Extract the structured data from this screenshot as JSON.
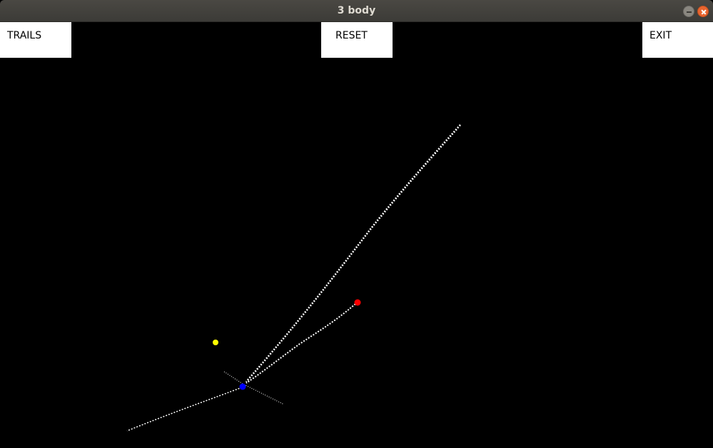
{
  "window": {
    "title": "3 body"
  },
  "toolbar": {
    "trails_label": "TRAILS",
    "reset_label": "RESET",
    "exit_label": "EXIT"
  },
  "bodies": [
    {
      "name": "yellow",
      "color": "#ffff00"
    },
    {
      "name": "red",
      "color": "#ff0000"
    },
    {
      "name": "blue",
      "color": "#0000ff"
    }
  ],
  "colors": {
    "background": "#000000",
    "trail": "#ffffff",
    "button_bg": "#ffffff"
  }
}
